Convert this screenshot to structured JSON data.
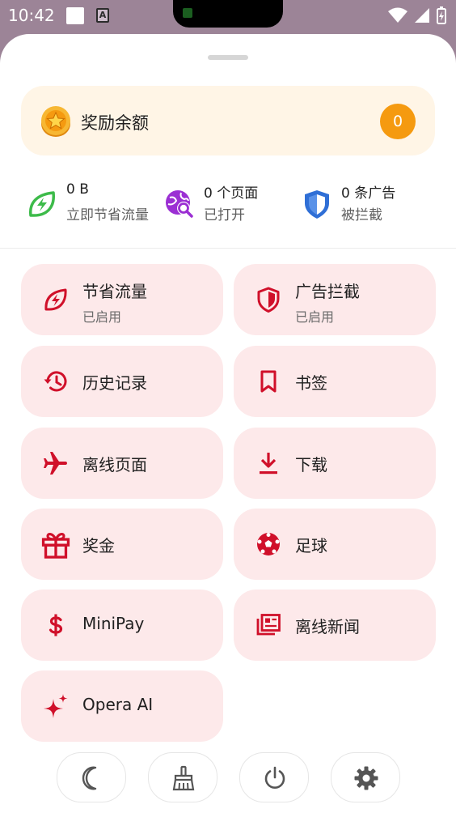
{
  "status_bar": {
    "time": "10:42",
    "notification_icon": "A"
  },
  "reward": {
    "label": "奖励余额",
    "balance": "0",
    "icon": "star-coin-icon"
  },
  "stats": [
    {
      "value": "0 B",
      "sub": "立即节省流量",
      "icon": "data-saver-icon",
      "color": "#3dbb4a"
    },
    {
      "value": "0 个页面",
      "sub": "已打开",
      "icon": "globe-search-icon",
      "color": "#9b2fd3"
    },
    {
      "value": "0 条广告",
      "sub": "被拦截",
      "icon": "shield-icon",
      "color": "#2f6fd6"
    }
  ],
  "tiles": [
    {
      "label": "节省流量",
      "sub": "已启用",
      "icon": "data-saver-icon"
    },
    {
      "label": "广告拦截",
      "sub": "已启用",
      "icon": "ad-block-shield-icon"
    },
    {
      "label": "历史记录",
      "icon": "history-icon"
    },
    {
      "label": "书签",
      "icon": "bookmark-icon"
    },
    {
      "label": "离线页面",
      "icon": "airplane-icon"
    },
    {
      "label": "下载",
      "icon": "download-icon"
    },
    {
      "label": "奖金",
      "icon": "gift-icon"
    },
    {
      "label": "足球",
      "icon": "soccer-ball-icon"
    },
    {
      "label": "MiniPay",
      "icon": "dollar-icon"
    },
    {
      "label": "离线新闻",
      "icon": "offline-news-icon"
    },
    {
      "label": "Opera AI",
      "icon": "sparkle-icon"
    }
  ],
  "bottom_buttons": [
    "moon-icon",
    "broom-icon",
    "power-icon",
    "gear-icon"
  ],
  "colors": {
    "accent_red": "#d0102a",
    "tile_bg": "#fde9ea",
    "reward_bg": "#fff5e6",
    "badge_orange": "#f59a10"
  }
}
